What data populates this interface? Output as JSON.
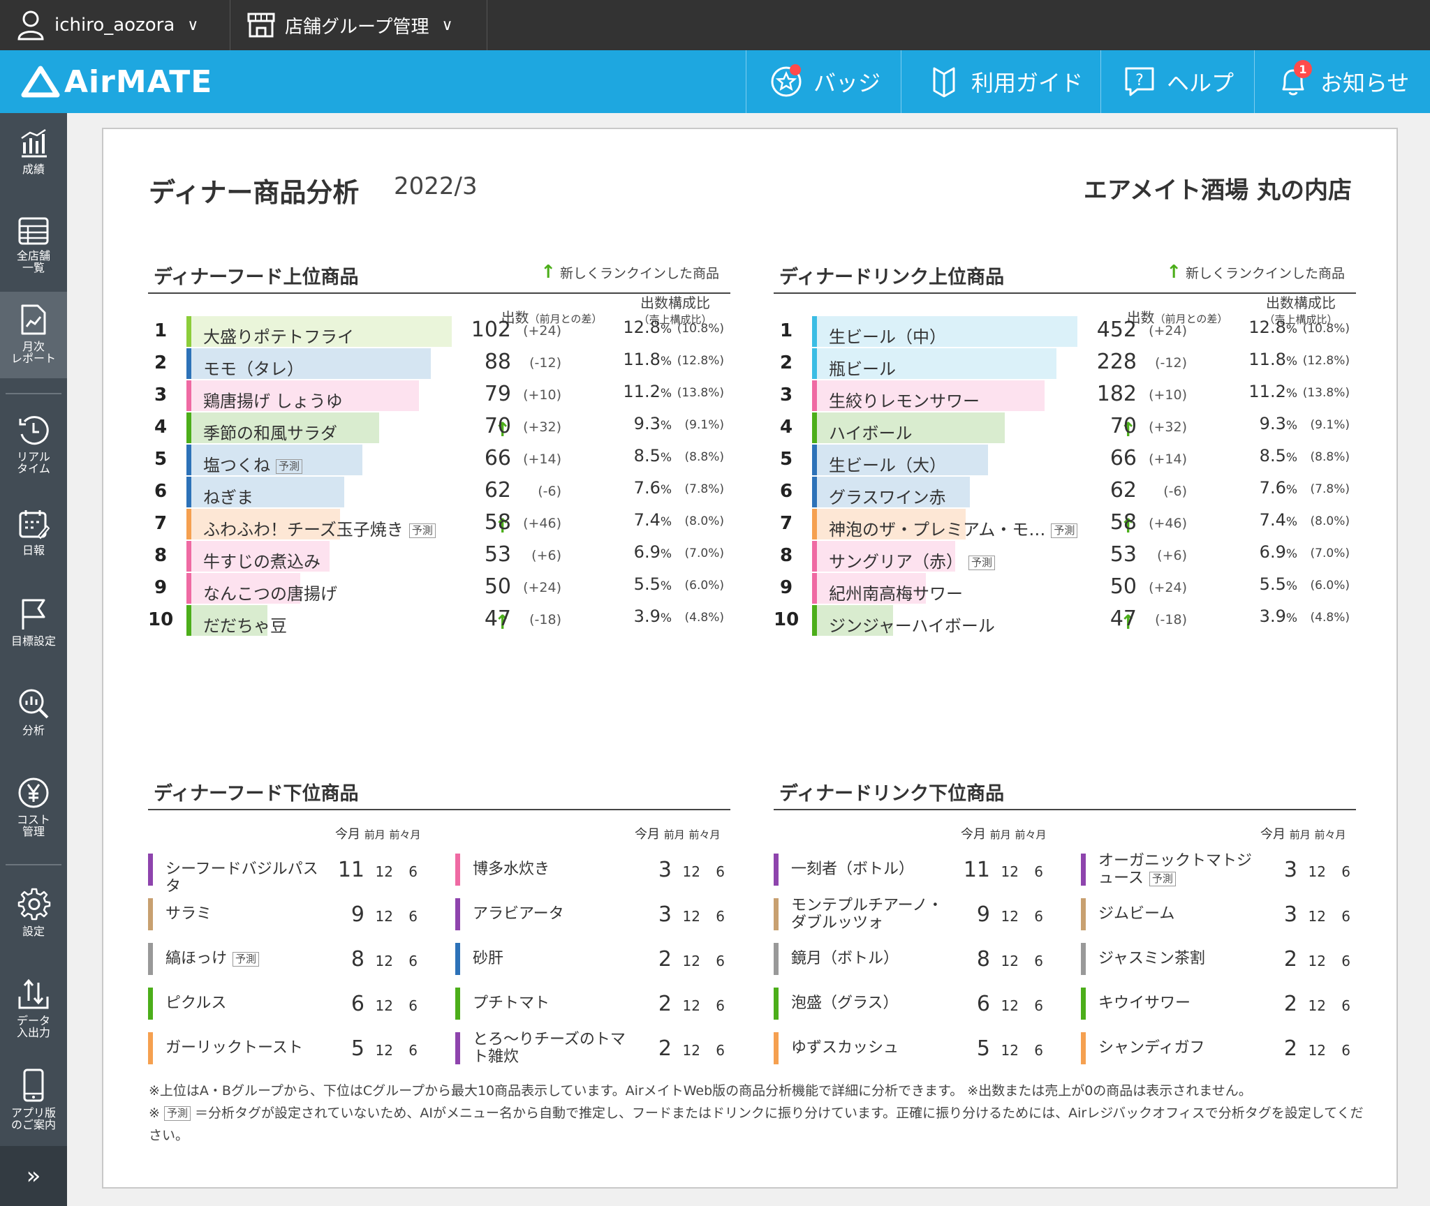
{
  "topbar": {
    "user": "ichiro_aozora",
    "group": "店舗グループ管理"
  },
  "header": {
    "logo": "AirMATE",
    "buttons": [
      {
        "label": "バッジ",
        "icon": "star-badge-icon"
      },
      {
        "label": "利用ガイド",
        "icon": "guide-icon"
      },
      {
        "label": "ヘルプ",
        "icon": "help-icon"
      },
      {
        "label": "お知らせ",
        "icon": "bell-icon",
        "badge": "1"
      }
    ]
  },
  "sidebar": {
    "items": [
      {
        "label": "成績",
        "icon": "chart-bar-icon"
      },
      {
        "label": "全店舗\n一覧",
        "icon": "table-icon"
      },
      {
        "label": "月次\nレポート",
        "icon": "report-icon",
        "active": true
      },
      {
        "label": "リアル\nタイム",
        "icon": "clock-icon"
      },
      {
        "label": "日報",
        "icon": "calendar-icon"
      },
      {
        "label": "目標設定",
        "icon": "flag-icon"
      },
      {
        "label": "分析",
        "icon": "analysis-icon"
      },
      {
        "label": "コスト\n管理",
        "icon": "yen-icon"
      },
      {
        "label": "設定",
        "icon": "gear-icon"
      },
      {
        "label": "データ\n入出力",
        "icon": "data-io-icon"
      },
      {
        "label": "アプリ版\nのご案内",
        "icon": "phone-icon"
      }
    ],
    "expand": "»"
  },
  "report": {
    "title": "ディナー商品分析",
    "period": "2022/3",
    "store": "エアメイト酒場 丸の内店"
  },
  "new_note": "新しくランクインした商品",
  "col_headers": {
    "count": "出数",
    "count_sub": "（前月との差）",
    "ratio": "出数構成比",
    "ratio_sub": "（売上構成比）"
  },
  "low_headers": {
    "cur": "今月",
    "prev": "前月",
    "prev2": "前々月"
  },
  "tag_label": "予測",
  "food_top": {
    "heading": "ディナーフード上位商品",
    "items": [
      {
        "rank": "1",
        "name": "大盛りポテトフライ",
        "count": "102",
        "diff": "(+24)",
        "pct": "12.8",
        "sales": "(10.8%)",
        "share": 0.128,
        "color": "#8ccd3a",
        "bg": "#eaf5da"
      },
      {
        "rank": "2",
        "name": "モモ（タレ）",
        "count": "88",
        "diff": "(-12)",
        "pct": "11.8",
        "sales": "(12.8%)",
        "share": 0.118,
        "color": "#2d72b8",
        "bg": "#d5e5f2"
      },
      {
        "rank": "3",
        "name": "鶏唐揚げ しょうゆ",
        "count": "79",
        "diff": "(+10)",
        "pct": "11.2",
        "sales": "(13.8%)",
        "share": 0.112,
        "color": "#ef6aa3",
        "bg": "#fde2ef"
      },
      {
        "rank": "4",
        "name": "季節の和風サラダ",
        "count": "70",
        "diff": "(+32)",
        "pct": "9.3",
        "sales": "(9.1%)",
        "share": 0.093,
        "color": "#4cae1a",
        "bg": "#d9eccf",
        "new": true
      },
      {
        "rank": "5",
        "name": "塩つくね",
        "count": "66",
        "diff": "(+14)",
        "pct": "8.5",
        "sales": "(8.8%)",
        "share": 0.085,
        "color": "#2d72b8",
        "bg": "#d5e5f2",
        "tag": true
      },
      {
        "rank": "6",
        "name": "ねぎま",
        "count": "62",
        "diff": "(-6)",
        "pct": "7.6",
        "sales": "(7.8%)",
        "share": 0.076,
        "color": "#2d72b8",
        "bg": "#d5e5f2"
      },
      {
        "rank": "7",
        "name": "ふわふわ！チーズ玉子焼き",
        "count": "58",
        "diff": "(+46)",
        "pct": "7.4",
        "sales": "(8.0%)",
        "share": 0.074,
        "color": "#f5a050",
        "bg": "#fde7d5",
        "new": true,
        "tag": true
      },
      {
        "rank": "8",
        "name": "牛すじの煮込み",
        "count": "53",
        "diff": "(+6)",
        "pct": "6.9",
        "sales": "(7.0%)",
        "share": 0.069,
        "color": "#ef6aa3",
        "bg": "#fde2ef"
      },
      {
        "rank": "9",
        "name": "なんこつの唐揚げ",
        "count": "50",
        "diff": "(+24)",
        "pct": "5.5",
        "sales": "(6.0%)",
        "share": 0.055,
        "color": "#ef6aa3",
        "bg": "#fde2ef"
      },
      {
        "rank": "10",
        "name": "だだちゃ豆",
        "count": "47",
        "diff": "(-18)",
        "pct": "3.9",
        "sales": "(4.8%)",
        "share": 0.039,
        "color": "#4cae1a",
        "bg": "#d9eccf",
        "new": true
      }
    ]
  },
  "drink_top": {
    "heading": "ディナードリンク上位商品",
    "items": [
      {
        "rank": "1",
        "name": "生ビール（中）",
        "count": "452",
        "diff": "(+24)",
        "pct": "12.8",
        "sales": "(10.8%)",
        "share": 0.128,
        "color": "#3bbde4",
        "bg": "#dbf1f9"
      },
      {
        "rank": "2",
        "name": "瓶ビール",
        "count": "228",
        "diff": "(-12)",
        "pct": "11.8",
        "sales": "(12.8%)",
        "share": 0.118,
        "color": "#3bbde4",
        "bg": "#dbf1f9"
      },
      {
        "rank": "3",
        "name": "生絞りレモンサワー",
        "count": "182",
        "diff": "(+10)",
        "pct": "11.2",
        "sales": "(13.8%)",
        "share": 0.112,
        "color": "#ef6aa3",
        "bg": "#fde2ef"
      },
      {
        "rank": "4",
        "name": "ハイボール",
        "count": "70",
        "diff": "(+32)",
        "pct": "9.3",
        "sales": "(9.1%)",
        "share": 0.093,
        "color": "#4cae1a",
        "bg": "#d9eccf",
        "new": true
      },
      {
        "rank": "5",
        "name": "生ビール（大）",
        "count": "66",
        "diff": "(+14)",
        "pct": "8.5",
        "sales": "(8.8%)",
        "share": 0.085,
        "color": "#2d72b8",
        "bg": "#d5e5f2"
      },
      {
        "rank": "6",
        "name": "グラスワイン赤",
        "count": "62",
        "diff": "(-6)",
        "pct": "7.6",
        "sales": "(7.8%)",
        "share": 0.076,
        "color": "#2d72b8",
        "bg": "#d5e5f2"
      },
      {
        "rank": "7",
        "name": "神泡のザ・プレミアム・モ…",
        "count": "58",
        "diff": "(+46)",
        "pct": "7.4",
        "sales": "(8.0%)",
        "share": 0.074,
        "color": "#f5a050",
        "bg": "#fde7d5",
        "new": true,
        "tag": true
      },
      {
        "rank": "8",
        "name": "サングリア（赤）",
        "count": "53",
        "diff": "(+6)",
        "pct": "6.9",
        "sales": "(7.0%)",
        "share": 0.069,
        "color": "#ef6aa3",
        "bg": "#fde2ef",
        "tag": true
      },
      {
        "rank": "9",
        "name": "紀州南高梅サワー",
        "count": "50",
        "diff": "(+24)",
        "pct": "5.5",
        "sales": "(6.0%)",
        "share": 0.055,
        "color": "#ef6aa3",
        "bg": "#fde2ef"
      },
      {
        "rank": "10",
        "name": "ジンジャーハイボール",
        "count": "47",
        "diff": "(-18)",
        "pct": "3.9",
        "sales": "(4.8%)",
        "share": 0.039,
        "color": "#4cae1a",
        "bg": "#d9eccf",
        "new": true
      }
    ]
  },
  "food_low": {
    "heading": "ディナーフード下位商品",
    "cols": [
      [
        {
          "name": "シーフードバジルパスタ",
          "cur": "11",
          "prev": "12",
          "prev2": "6",
          "color": "#8e44ad"
        },
        {
          "name": "サラミ",
          "cur": "9",
          "prev": "12",
          "prev2": "6",
          "color": "#c8a070"
        },
        {
          "name": "縞ほっけ",
          "cur": "8",
          "prev": "12",
          "prev2": "6",
          "color": "#999999",
          "tag": true
        },
        {
          "name": "ピクルス",
          "cur": "6",
          "prev": "12",
          "prev2": "6",
          "color": "#4cae1a"
        },
        {
          "name": "ガーリックトースト",
          "cur": "5",
          "prev": "12",
          "prev2": "6",
          "color": "#f5a050"
        }
      ],
      [
        {
          "name": "博多水炊き",
          "cur": "3",
          "prev": "12",
          "prev2": "6",
          "color": "#ef6aa3"
        },
        {
          "name": "アラビアータ",
          "cur": "3",
          "prev": "12",
          "prev2": "6",
          "color": "#8e44ad"
        },
        {
          "name": "砂肝",
          "cur": "2",
          "prev": "12",
          "prev2": "6",
          "color": "#2d72b8"
        },
        {
          "name": "プチトマト",
          "cur": "2",
          "prev": "12",
          "prev2": "6",
          "color": "#4cae1a"
        },
        {
          "name": "とろ〜りチーズのトマト雑炊",
          "cur": "2",
          "prev": "12",
          "prev2": "6",
          "color": "#8e44ad"
        }
      ]
    ]
  },
  "drink_low": {
    "heading": "ディナードリンク下位商品",
    "cols": [
      [
        {
          "name": "一刻者（ボトル）",
          "cur": "11",
          "prev": "12",
          "prev2": "6",
          "color": "#8e44ad"
        },
        {
          "name": "モンテプルチアーノ・ダブルッツォ",
          "cur": "9",
          "prev": "12",
          "prev2": "6",
          "color": "#c8a070"
        },
        {
          "name": "鏡月（ボトル）",
          "cur": "8",
          "prev": "12",
          "prev2": "6",
          "color": "#999999"
        },
        {
          "name": "泡盛（グラス）",
          "cur": "6",
          "prev": "12",
          "prev2": "6",
          "color": "#4cae1a"
        },
        {
          "name": "ゆずスカッシュ",
          "cur": "5",
          "prev": "12",
          "prev2": "6",
          "color": "#f5a050"
        }
      ],
      [
        {
          "name": "オーガニックトマトジュース",
          "cur": "3",
          "prev": "12",
          "prev2": "6",
          "color": "#8e44ad",
          "tag": true
        },
        {
          "name": "ジムビーム",
          "cur": "3",
          "prev": "12",
          "prev2": "6",
          "color": "#c8a070"
        },
        {
          "name": "ジャスミン茶割",
          "cur": "2",
          "prev": "12",
          "prev2": "6",
          "color": "#999999"
        },
        {
          "name": "キウイサワー",
          "cur": "2",
          "prev": "12",
          "prev2": "6",
          "color": "#4cae1a"
        },
        {
          "name": "シャンディガフ",
          "cur": "2",
          "prev": "12",
          "prev2": "6",
          "color": "#f5a050"
        }
      ]
    ]
  },
  "footnote1": "※上位はA・Bグループから、下位はCグループから最大10商品表示しています。AirメイトWeb版の商品分析機能で詳細に分析できます。 ※出数または売上が0の商品は表示されません。",
  "footnote2_pre": "※",
  "footnote2": "＝分析タグが設定されていないため、AIがメニュー名から自動で推定し、フードまたはドリンクに振り分けています。正確に振り分けるためには、Airレジバックオフィスで分析タグを設定してください。"
}
